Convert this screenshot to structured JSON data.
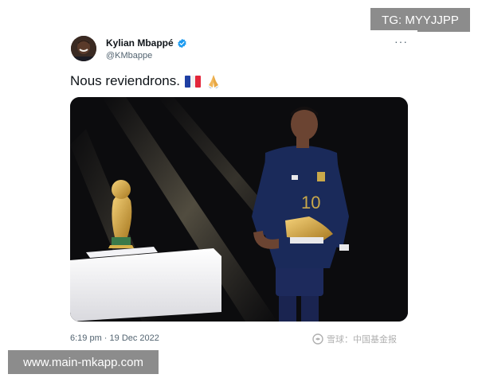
{
  "overlay": {
    "tg_label": "TG: MYYJJPP",
    "url_label": "www.main-mkapp.com"
  },
  "tweet": {
    "author_name": "Kylian Mbappé",
    "handle": "@KMbappe",
    "more_icon": "more-options-icon",
    "text": "Nous reviendrons.",
    "emojis": [
      "flag-france-icon",
      "folded-hands-icon"
    ],
    "timestamp": "6:19 pm · 19 Dec 2022",
    "photo": {
      "jersey_number": "10",
      "description_icons": [
        "world-cup-trophy-icon",
        "golden-boot-icon"
      ]
    },
    "watermark": "雪球：中国基金报"
  },
  "colors": {
    "verified_blue": "#1d9bf0",
    "jersey_navy": "#1a2a5a",
    "photo_background": "#0c0c0e",
    "gold": "#d4a43a"
  }
}
